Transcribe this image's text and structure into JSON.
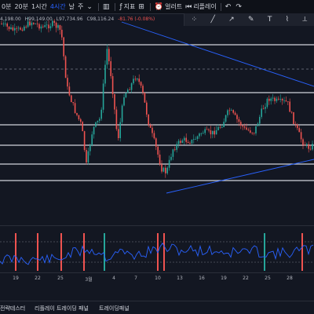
{
  "toolbar": {
    "intervals": [
      "0분",
      "20분",
      "1시간",
      "4시간",
      "날",
      "주"
    ],
    "active_interval": "4시간",
    "candles_icon": "candlestick-icon",
    "chevron_icon": "chevron-down-icon",
    "indicator_label": "지표",
    "grid_icon": "grid-icon",
    "alert_label": "얼러트",
    "replay_label": "리플레이",
    "undo_icon": "undo-icon",
    "redo_icon": "redo-icon"
  },
  "legend": {
    "values": [
      "4,198.00",
      "99,149.00",
      "97,734.96",
      "98,116.24",
      "-81.76 (-0.08%)"
    ],
    "prefixes": [
      "",
      "",
      "",
      "C",
      ""
    ]
  },
  "drawing_tools": [
    "crosshair-icon",
    "trend-line-icon",
    "arrow-icon",
    "pen-icon",
    "text-icon",
    "brush-icon",
    "ruler-icon"
  ],
  "time_axis": {
    "ticks": [
      "19",
      "22",
      "25",
      "3월",
      "4",
      "7",
      "10",
      "13",
      "16",
      "19",
      "22",
      "25",
      "28"
    ]
  },
  "bottom_bar": {
    "tabs": [
      "전략테스터",
      "리플레이 트레이딩 패널",
      "트레이딩패널"
    ]
  },
  "colors": {
    "background": "#131722",
    "up": "#26a69a",
    "down": "#ef5350",
    "level": "#ffffff",
    "trendline": "#2962ff",
    "oscillator": "#2962ff"
  }
}
